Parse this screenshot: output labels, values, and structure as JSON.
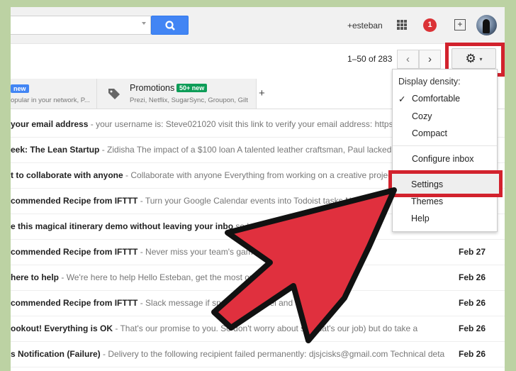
{
  "header": {
    "user": "+esteban",
    "notification_count": "1",
    "search_placeholder": ""
  },
  "toolbar": {
    "pager": "1–50 of 283",
    "prev": "‹",
    "next": "›",
    "gear": "⚙",
    "gear_caret": "▾"
  },
  "tabs": [
    {
      "badge": "new",
      "snippet": "opular in your network, P...",
      "badge_color": "#4285f4"
    },
    {
      "label": "Promotions",
      "badge": "50+ new",
      "snippet": "Prezi, Netflix, SugarSync, Groupon, Gilt",
      "badge_color": "#0e9d58"
    }
  ],
  "tab_add": "+",
  "emails": [
    {
      "subject": "your email address",
      "snippet": "- your username is: Steve021020 visit this link to verify your email address: https://w",
      "date": ""
    },
    {
      "subject": "eek: The Lean Startup",
      "snippet": "- Zidisha The impact of a $100 loan A talented leather craftsman, Paul lacked the",
      "date": ""
    },
    {
      "subject": "t to collaborate with anyone",
      "snippet": "- Collaborate with anyone Everything from working on a creative project to",
      "date": ""
    },
    {
      "subject": "commended Recipe from IFTTT",
      "snippet": "- Turn your Google Calendar events into Todoist tasks Note",
      "date": ""
    },
    {
      "subject": "e this magical itinerary demo without leaving your inbo",
      "snippet": "se l",
      "date": ""
    },
    {
      "subject": "commended Recipe from IFTTT",
      "snippet": "- Never miss your team's game d                    Select your team f",
      "date": "Feb 27"
    },
    {
      "subject": "here to help",
      "snippet": "- We're here to help Hello Esteban, get the most out                    Support Center.",
      "date": "Feb 26"
    },
    {
      "subject": "commended Recipe from IFTTT",
      "snippet": "- Slack message if sn                    Slack channel and enjoy! A",
      "date": "Feb 26"
    },
    {
      "subject": "ookout! Everything is OK",
      "snippet": "- That's our promise to you. So don't worry about se      (that's our job) but do take a",
      "date": "Feb 26"
    },
    {
      "subject": "s Notification (Failure)",
      "snippet": "- Delivery to the following recipient failed permanently: djsjcisks@gmail.com Technical deta",
      "date": "Feb 26"
    }
  ],
  "menu": {
    "heading": "Display density:",
    "check": "✓",
    "items": [
      "Comfortable",
      "Cozy",
      "Compact",
      "Configure inbox",
      "Settings",
      "Themes",
      "Help"
    ]
  },
  "colors": {
    "highlight": "#d2222d",
    "arrow": "#e0303e",
    "background": "#bcd2a3"
  }
}
